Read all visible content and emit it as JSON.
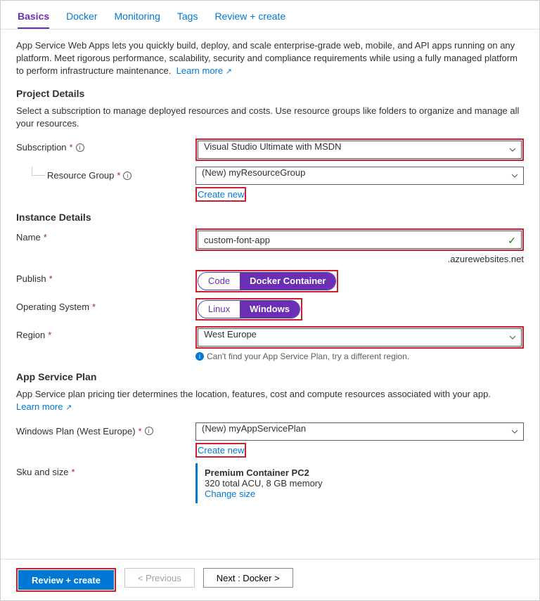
{
  "tabs": [
    "Basics",
    "Docker",
    "Monitoring",
    "Tags",
    "Review + create"
  ],
  "intro": {
    "text": "App Service Web Apps lets you quickly build, deploy, and scale enterprise-grade web, mobile, and API apps running on any platform. Meet rigorous performance, scalability, security and compliance requirements while using a fully managed platform to perform infrastructure maintenance.",
    "learn": "Learn more"
  },
  "project": {
    "title": "Project Details",
    "desc": "Select a subscription to manage deployed resources and costs. Use resource groups like folders to organize and manage all your resources.",
    "subscription_label": "Subscription",
    "subscription_value": "Visual Studio Ultimate with MSDN",
    "rg_label": "Resource Group",
    "rg_value": "(New) myResourceGroup",
    "create_new": "Create new"
  },
  "instance": {
    "title": "Instance Details",
    "name_label": "Name",
    "name_value": "custom-font-app",
    "suffix": ".azurewebsites.net",
    "publish_label": "Publish",
    "publish_opts": [
      "Code",
      "Docker Container"
    ],
    "os_label": "Operating System",
    "os_opts": [
      "Linux",
      "Windows"
    ],
    "region_label": "Region",
    "region_value": "West Europe",
    "region_hint": "Can't find your App Service Plan, try a different region."
  },
  "plan": {
    "title": "App Service Plan",
    "desc": "App Service plan pricing tier determines the location, features, cost and compute resources associated with your app.",
    "learn": "Learn more",
    "plan_label": "Windows Plan (West Europe)",
    "plan_value": "(New) myAppServicePlan",
    "create_new": "Create new",
    "sku_label": "Sku and size",
    "sku_name": "Premium Container PC2",
    "sku_detail": "320 total ACU, 8 GB memory",
    "change": "Change size"
  },
  "footer": {
    "review": "Review + create",
    "prev": "< Previous",
    "next": "Next : Docker >"
  }
}
